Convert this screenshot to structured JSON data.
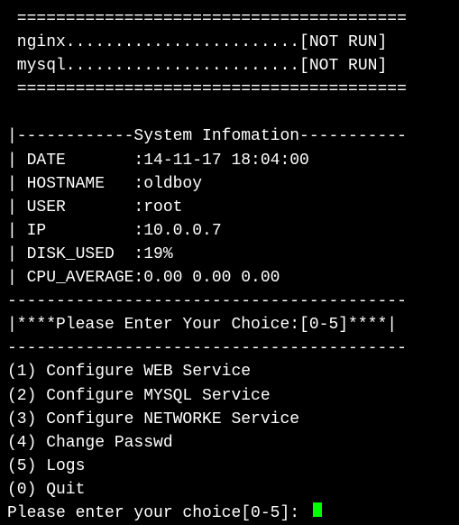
{
  "divider_thick": " ========================================",
  "services": {
    "nginx_line": " nginx........................[NOT RUN]",
    "mysql_line": " mysql........................[NOT RUN]"
  },
  "sysinfo": {
    "header": "|------------System Infomation-----------",
    "rows": [
      "| DATE       :14-11-17 18:04:00",
      "| HOSTNAME   :oldboy",
      "| USER       :root",
      "| IP         :10.0.0.7",
      "| DISK_USED  :19%",
      "| CPU_AVERAGE:0.00 0.00 0.00"
    ]
  },
  "divider_thin": "-----------------------------------------",
  "choice_header": "|****Please Enter Your Choice:[0-5]****|",
  "menu": [
    "(1) Configure WEB Service",
    "(2) Configure MYSQL Service",
    "(3) Configure NETWORKE Service",
    "(4) Change Passwd",
    "(5) Logs",
    "(0) Quit"
  ],
  "prompt": "Please enter your choice[0-5]: "
}
